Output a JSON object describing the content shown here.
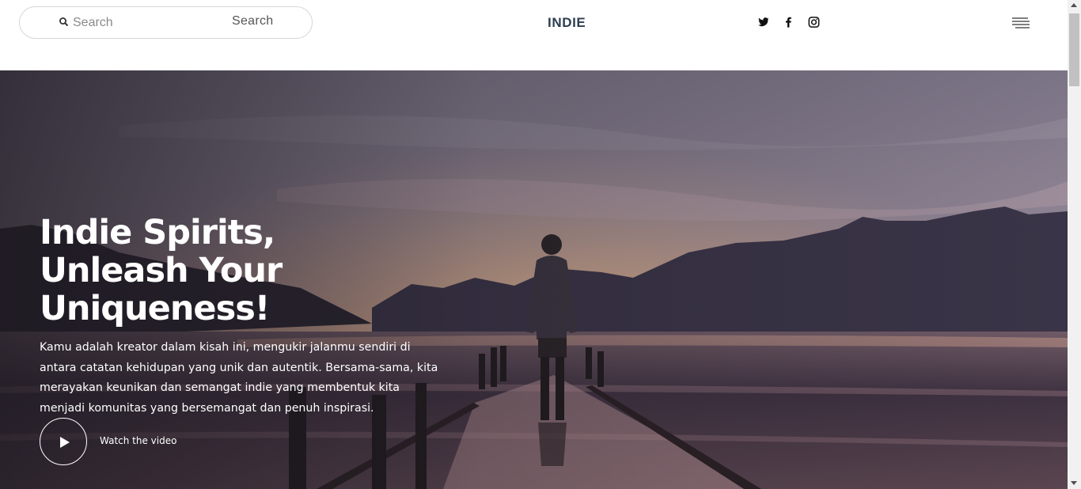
{
  "header": {
    "search_placeholder": "Search",
    "search_button": "Search",
    "brand": "INDIE",
    "socials": [
      "twitter-icon",
      "facebook-icon",
      "instagram-icon"
    ],
    "menu_icon": "hamburger-menu-icon"
  },
  "hero": {
    "title_lines": [
      "Indie Spirits,",
      "Unleash Your",
      "Uniqueness!"
    ],
    "description": "Kamu adalah kreator dalam kisah ini, mengukir jalanmu sendiri di antara catatan kehidupan yang unik dan autentik. Bersama-sama, kita merayakan keunikan dan semangat indie yang membentuk kita menjadi komunitas yang bersemangat dan penuh inspirasi.",
    "video_label": "Watch the video",
    "play_icon": "play-icon"
  },
  "colors": {
    "brand_text": "#2c3e50",
    "hero_text": "#ffffff"
  }
}
